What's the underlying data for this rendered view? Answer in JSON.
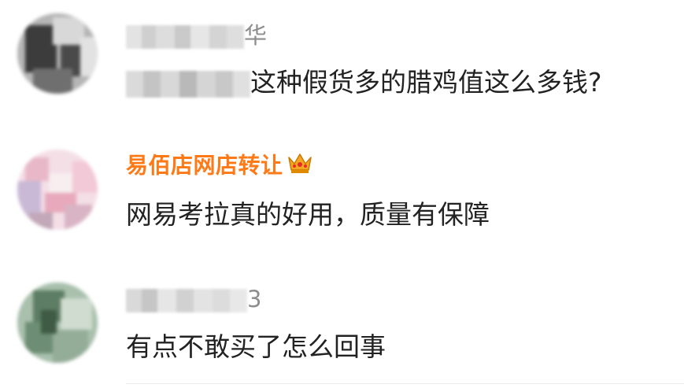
{
  "comments": [
    {
      "username_visible": "华",
      "content_visible": "这种假货多的腊鸡值这么多钱?"
    },
    {
      "username": "易佰店网店转让",
      "content": "网易考拉真的好用，质量有保障"
    },
    {
      "username_visible": "3",
      "content": "有点不敢买了怎么回事"
    }
  ],
  "colors": {
    "vip_username": "#ff7a17",
    "plain_username": "#8d8d8d",
    "content_text": "#222222",
    "crown": "#f5a623"
  }
}
